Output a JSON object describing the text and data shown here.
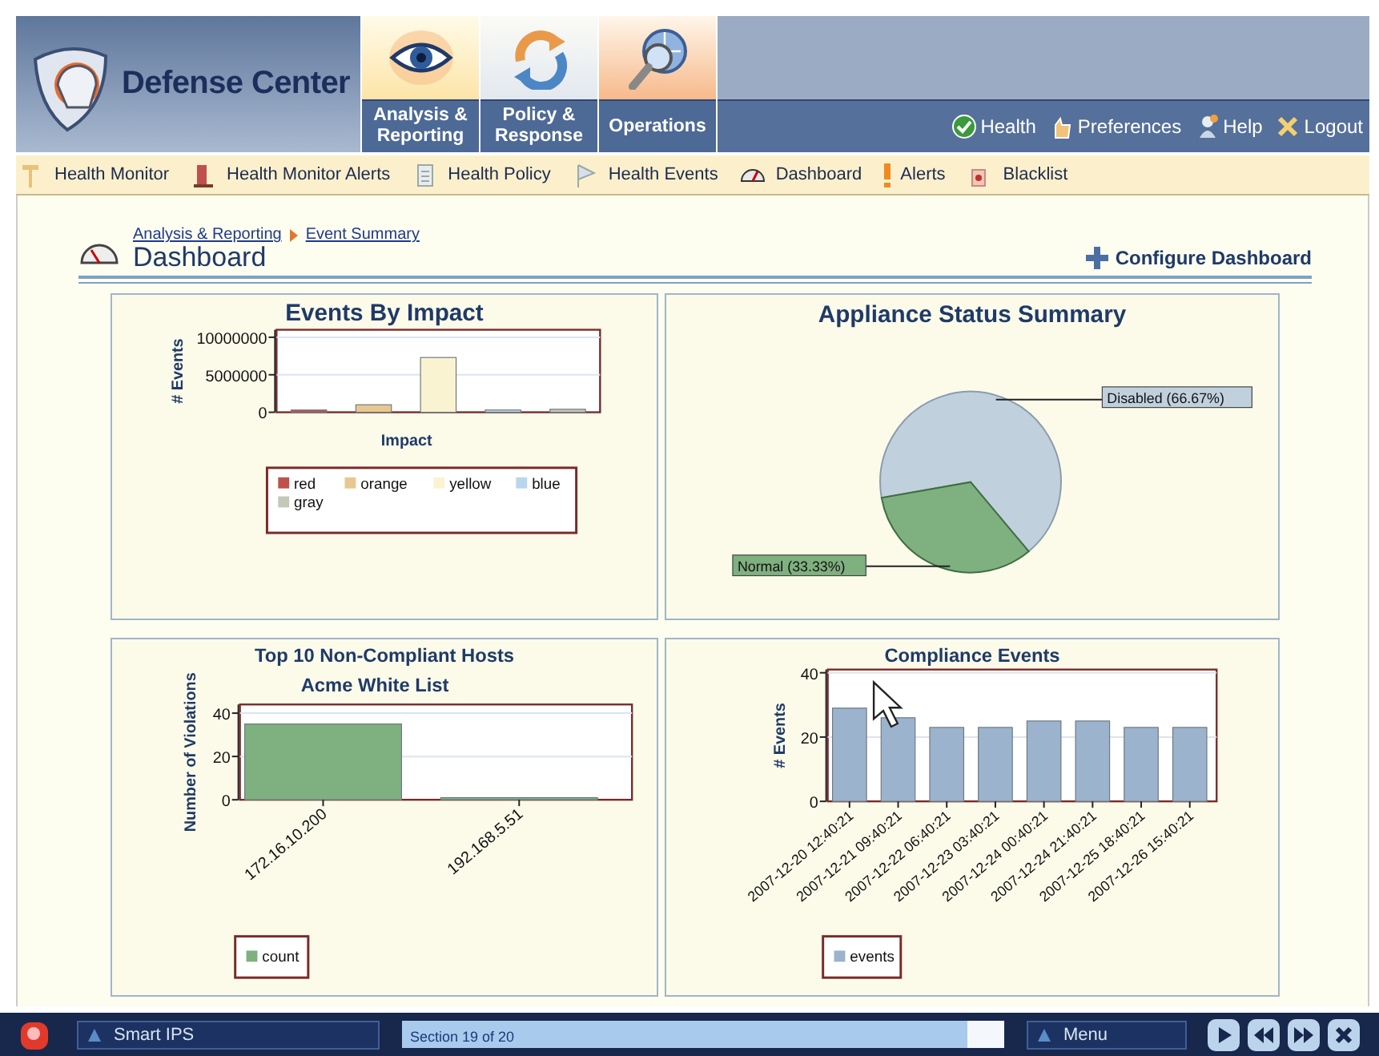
{
  "app": {
    "title": "Defense Center"
  },
  "main_tabs": [
    {
      "label": "Analysis & Reporting"
    },
    {
      "label": "Policy & Response"
    },
    {
      "label": "Operations"
    }
  ],
  "header_links": [
    {
      "label": "Health"
    },
    {
      "label": "Preferences"
    },
    {
      "label": "Help"
    },
    {
      "label": "Logout"
    }
  ],
  "toolbar": [
    {
      "label": "Health Monitor"
    },
    {
      "label": "Health Monitor Alerts"
    },
    {
      "label": "Health Policy"
    },
    {
      "label": "Health Events"
    },
    {
      "label": "Dashboard"
    },
    {
      "label": "Alerts"
    },
    {
      "label": "Blacklist"
    }
  ],
  "breadcrumb": [
    "Analysis & Reporting",
    "Event Summary"
  ],
  "page_title": "Dashboard",
  "configure_button": "Configure Dashboard",
  "widgets": [
    {
      "title": "Events By Impact",
      "chart_data": {
        "type": "bar",
        "legend": "bottom",
        "xlabel": "Impact",
        "ylabel": "# Events",
        "ylim": [
          0,
          11000000
        ],
        "yticks": [
          0,
          5000000,
          10000000
        ],
        "series": [
          {
            "name": "red",
            "color": "#c0504d",
            "values": [
              300000
            ]
          },
          {
            "name": "orange",
            "color": "#e8c890",
            "values": [
              1000000
            ]
          },
          {
            "name": "yellow",
            "color": "#faf3d2",
            "values": [
              7300000
            ]
          },
          {
            "name": "blue",
            "color": "#b9d6ec",
            "values": [
              300000
            ]
          },
          {
            "name": "gray",
            "color": "#c3c8b8",
            "values": [
              400000
            ]
          }
        ]
      }
    },
    {
      "title": "Appliance Status Summary",
      "chart_data": {
        "type": "pie",
        "categories": [
          "Disabled (66.67%)",
          "Normal (33.33%)"
        ],
        "values": [
          66.67,
          33.33
        ],
        "colors": [
          "#c1d0dd",
          "#7fb07f"
        ]
      }
    },
    {
      "title": "Top 10 Non-Compliant Hosts",
      "chart_data": {
        "type": "bar",
        "legend": "bottom",
        "title": "Acme White List",
        "ylabel": "Number of Violations",
        "categories": [
          "172.16.10.200",
          "192.168.5.51"
        ],
        "ylim": [
          0,
          44
        ],
        "yticks": [
          0,
          20,
          40
        ],
        "series": [
          {
            "name": "count",
            "color": "#7fb07f",
            "values": [
              35,
              1
            ]
          }
        ]
      }
    },
    {
      "title": "Compliance Events",
      "chart_data": {
        "type": "bar",
        "legend": "bottom",
        "ylabel": "# Events",
        "categories": [
          "2007-12-20 12:40:21",
          "2007-12-21 09:40:21",
          "2007-12-22 06:40:21",
          "2007-12-23 03:40:21",
          "2007-12-24 00:40:21",
          "2007-12-24 21:40:21",
          "2007-12-25 18:40:21",
          "2007-12-26 15:40:21"
        ],
        "ylim": [
          0,
          41
        ],
        "yticks": [
          0,
          20,
          40
        ],
        "series": [
          {
            "name": "events",
            "color": "#9bb3cc",
            "values": [
              29,
              26,
              23,
              23,
              25,
              25,
              23,
              23
            ]
          }
        ]
      }
    }
  ],
  "taskbar": {
    "app_menu": "Smart IPS",
    "progress": {
      "label": "Section 19 of 20",
      "level": 0.94
    },
    "menu": "Menu"
  }
}
